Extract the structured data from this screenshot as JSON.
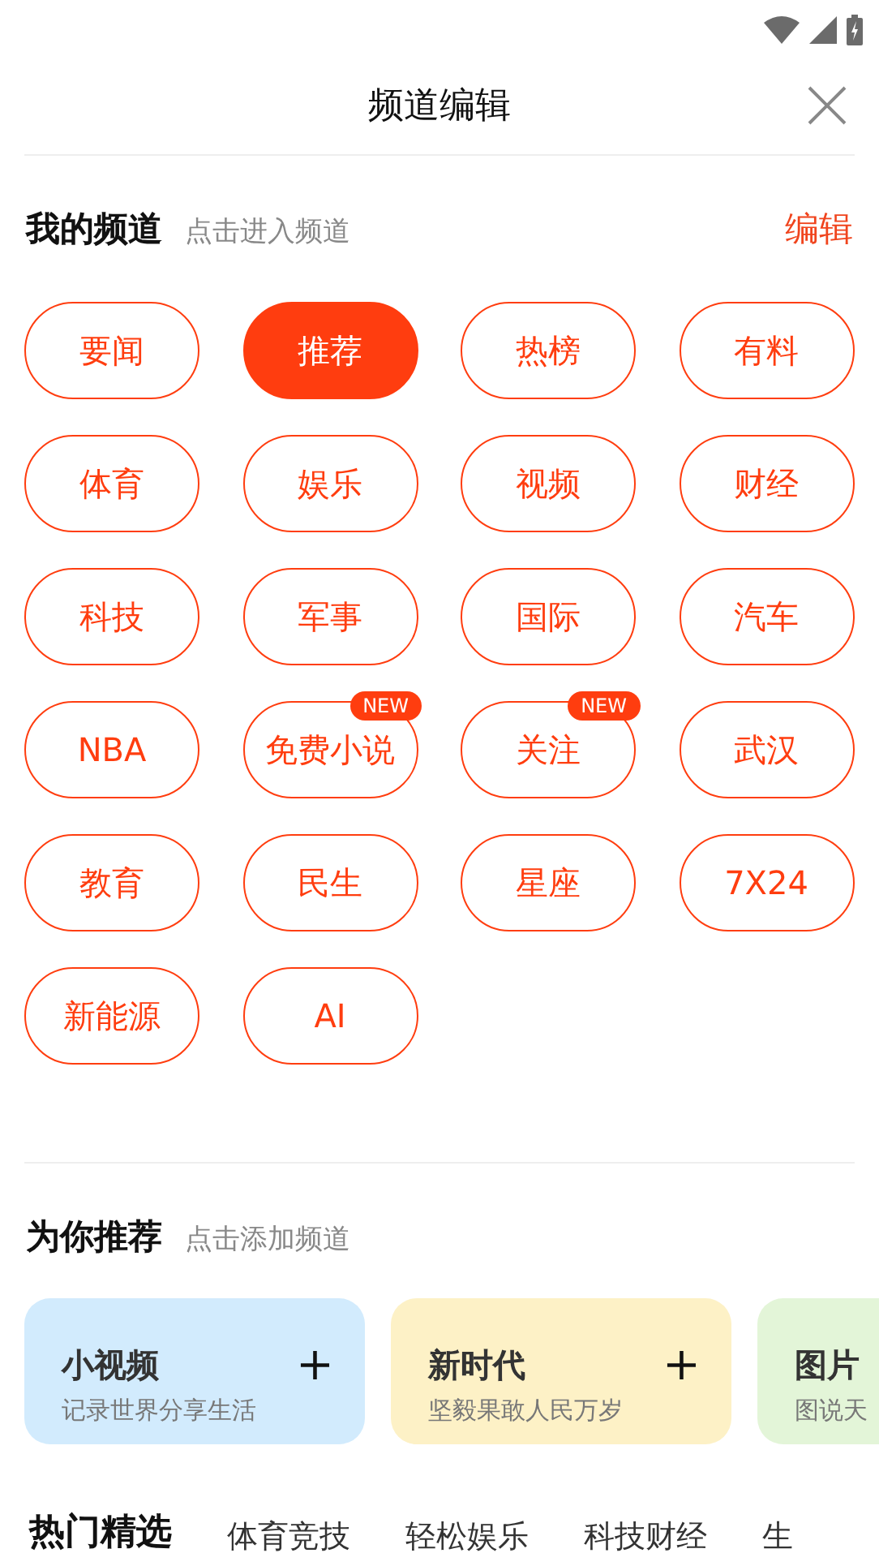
{
  "header": {
    "title": "频道编辑"
  },
  "my_channels": {
    "title": "我的频道",
    "hint": "点击进入频道",
    "edit": "编辑",
    "items": [
      {
        "label": "要闻",
        "selected": false
      },
      {
        "label": "推荐",
        "selected": true
      },
      {
        "label": "热榜",
        "selected": false
      },
      {
        "label": "有料",
        "selected": false
      },
      {
        "label": "体育",
        "selected": false
      },
      {
        "label": "娱乐",
        "selected": false
      },
      {
        "label": "视频",
        "selected": false
      },
      {
        "label": "财经",
        "selected": false
      },
      {
        "label": "科技",
        "selected": false
      },
      {
        "label": "军事",
        "selected": false
      },
      {
        "label": "国际",
        "selected": false
      },
      {
        "label": "汽车",
        "selected": false
      },
      {
        "label": "NBA",
        "selected": false
      },
      {
        "label": "免费小说",
        "selected": false,
        "badge": "NEW"
      },
      {
        "label": "关注",
        "selected": false,
        "badge": "NEW"
      },
      {
        "label": "武汉",
        "selected": false
      },
      {
        "label": "教育",
        "selected": false
      },
      {
        "label": "民生",
        "selected": false
      },
      {
        "label": "星座",
        "selected": false
      },
      {
        "label": "7X24",
        "selected": false
      },
      {
        "label": "新能源",
        "selected": false
      },
      {
        "label": "AI",
        "selected": false
      }
    ]
  },
  "recommend": {
    "title": "为你推荐",
    "hint": "点击添加频道",
    "cards": [
      {
        "title": "小视频",
        "subtitle": "记录世界分享生活",
        "color": "#d2ebfd",
        "add": "+"
      },
      {
        "title": "新时代",
        "subtitle": "坚毅果敢人民万岁",
        "color": "#fdf1c6",
        "add": "+"
      },
      {
        "title": "图片",
        "subtitle": "图说天",
        "color": "#e3f5d8"
      }
    ]
  },
  "category_tabs": [
    {
      "label": "热门精选",
      "selected": true
    },
    {
      "label": "体育竞技",
      "selected": false
    },
    {
      "label": "轻松娱乐",
      "selected": false
    },
    {
      "label": "科技财经",
      "selected": false
    },
    {
      "label": "生",
      "selected": false
    }
  ]
}
